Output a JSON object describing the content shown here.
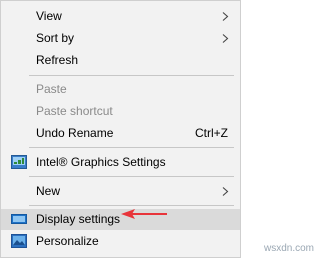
{
  "menu": {
    "view": "View",
    "sort_by": "Sort by",
    "refresh": "Refresh",
    "paste": "Paste",
    "paste_shortcut": "Paste shortcut",
    "undo_rename": "Undo Rename",
    "undo_rename_shortcut": "Ctrl+Z",
    "intel_graphics": "Intel® Graphics Settings",
    "new": "New",
    "display_settings": "Display settings",
    "personalize": "Personalize"
  },
  "annotation": {
    "arrow_color": "#e8343a"
  },
  "watermark": "wsxdn.com"
}
